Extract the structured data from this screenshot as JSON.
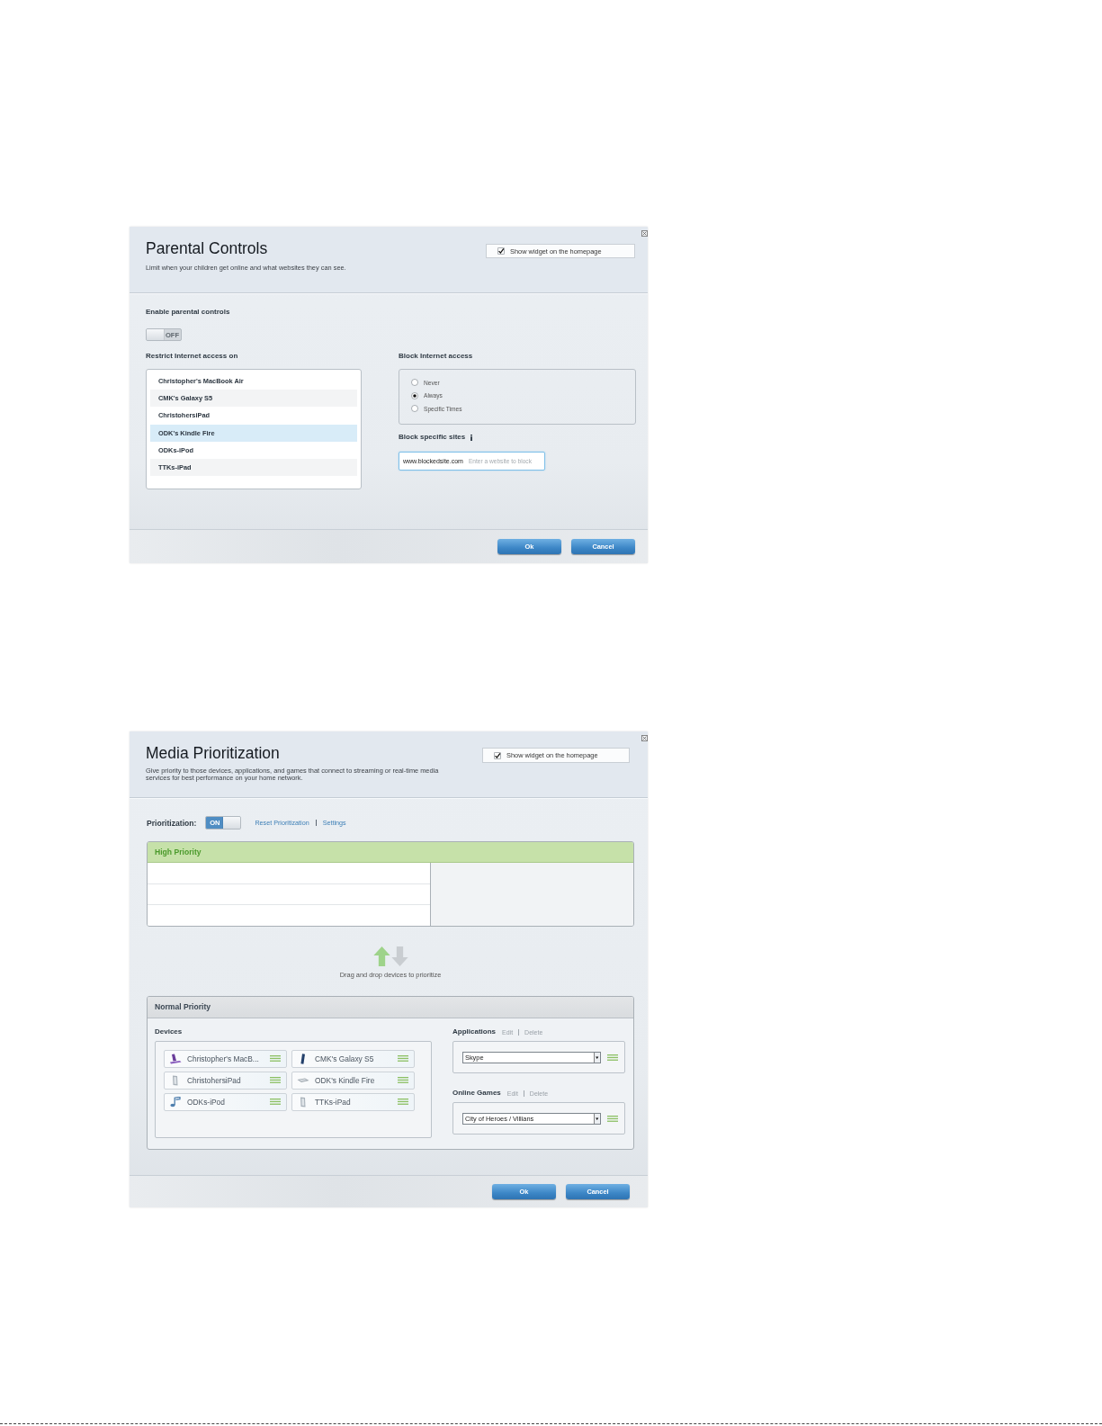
{
  "parental_controls": {
    "title": "Parental Controls",
    "description": "Limit when your children get online and what websites they can see.",
    "show_widget": {
      "label": "Show widget on the homepage",
      "checked": true
    },
    "enable": {
      "label": "Enable parental controls",
      "toggle": {
        "text": "OFF",
        "on": false
      }
    },
    "restrict": {
      "label": "Restrict Internet access on",
      "devices": [
        {
          "name": "Christopher's MacBook Air",
          "selected": false
        },
        {
          "name": "CMK's Galaxy S5",
          "selected": false
        },
        {
          "name": "ChristohersiPad",
          "selected": false
        },
        {
          "name": "ODK's Kindle Fire",
          "selected": true
        },
        {
          "name": "ODKs-iPod",
          "selected": false
        },
        {
          "name": "TTKs-iPad",
          "selected": false
        }
      ]
    },
    "block_access": {
      "label": "Block Internet access",
      "options": [
        {
          "label": "Never",
          "selected": false
        },
        {
          "label": "Always",
          "selected": true
        },
        {
          "label": "Specific Times",
          "selected": false
        }
      ]
    },
    "block_sites": {
      "label": "Block specific sites",
      "entries": [
        "www.blockedsite.com"
      ],
      "placeholder": "Enter a website to block"
    },
    "buttons": [
      "Ok",
      "Cancel"
    ]
  },
  "media_prioritization": {
    "title": "Media Prioritization",
    "description": "Give priority to those devices, applications, and games that connect to streaming or real-time media services for best performance on your home network.",
    "show_widget": {
      "label": "Show widget on the homepage",
      "checked": true
    },
    "prioritization": {
      "label": "Prioritization:",
      "toggle": {
        "text": "ON",
        "on": true
      },
      "links": [
        "Reset Prioritization",
        "Settings"
      ]
    },
    "high_priority": {
      "title": "High Priority"
    },
    "hint": "Drag and drop devices to prioritize",
    "normal_priority": {
      "title": "Normal Priority",
      "devices_label": "Devices",
      "devices": [
        {
          "name": "Christopher's MacB...",
          "kind": "laptop"
        },
        {
          "name": "CMK's Galaxy S5",
          "kind": "phone"
        },
        {
          "name": "ChristohersiPad",
          "kind": "tablet"
        },
        {
          "name": "ODK's Kindle Fire",
          "kind": "reader"
        },
        {
          "name": "ODKs-iPod",
          "kind": "player"
        },
        {
          "name": "TTKs-iPad",
          "kind": "tablet"
        }
      ],
      "applications": {
        "label": "Applications",
        "actions": [
          "Edit",
          "Delete"
        ],
        "items": [
          "Skype"
        ]
      },
      "online_games": {
        "label": "Online Games",
        "actions": [
          "Edit",
          "Delete"
        ],
        "items": [
          "City of Heroes / Villians"
        ]
      }
    },
    "buttons": [
      "Ok",
      "Cancel"
    ]
  }
}
